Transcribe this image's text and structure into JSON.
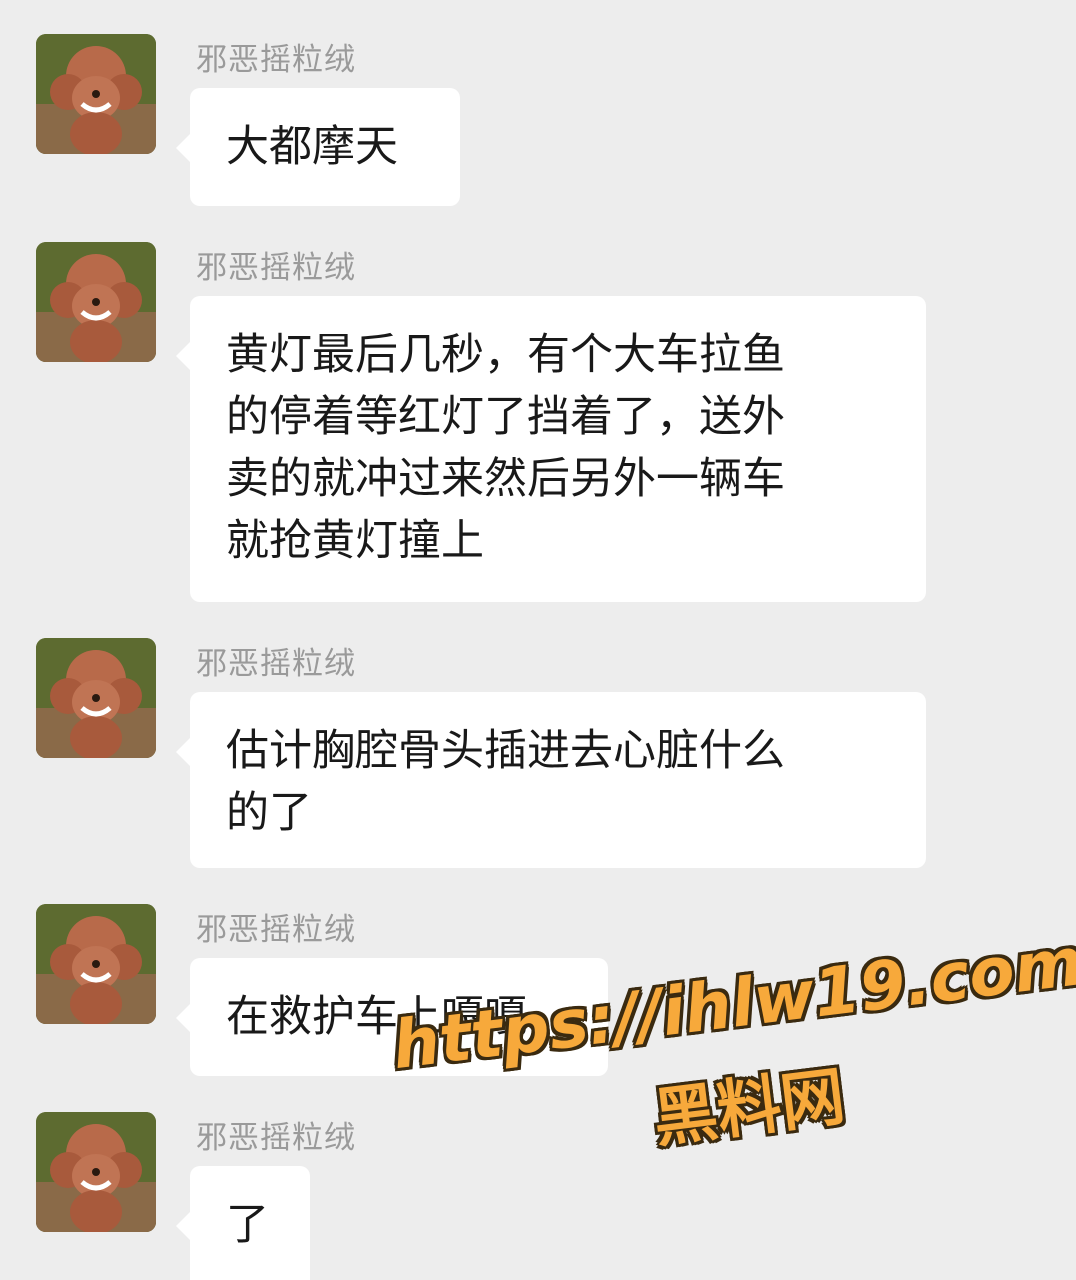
{
  "colors": {
    "background": "#ededed",
    "bubble": "#ffffff",
    "sender_text": "#9a9a9a",
    "message_text": "#191919",
    "watermark": "#f7a93b"
  },
  "messages": [
    {
      "sender": "邪恶摇粒绒",
      "avatar_icon": "poodle-avatar-icon",
      "lines": [
        "大都摩天"
      ]
    },
    {
      "sender": "邪恶摇粒绒",
      "avatar_icon": "poodle-avatar-icon",
      "lines": [
        "黄灯最后几秒，有个大车拉鱼",
        "的停着等红灯了挡着了，送外",
        "卖的就冲过来然后另外一辆车",
        "就抢黄灯撞上"
      ]
    },
    {
      "sender": "邪恶摇粒绒",
      "avatar_icon": "poodle-avatar-icon",
      "lines": [
        "估计胸腔骨头插进去心脏什么",
        "的了"
      ]
    },
    {
      "sender": "邪恶摇粒绒",
      "avatar_icon": "poodle-avatar-icon",
      "lines": [
        "在救护车上嘎嘎"
      ]
    },
    {
      "sender": "邪恶摇粒绒",
      "avatar_icon": "poodle-avatar-icon",
      "lines": [
        "了"
      ]
    }
  ],
  "watermark": {
    "url": "https://ihlw19.com",
    "name": "黑料网"
  }
}
